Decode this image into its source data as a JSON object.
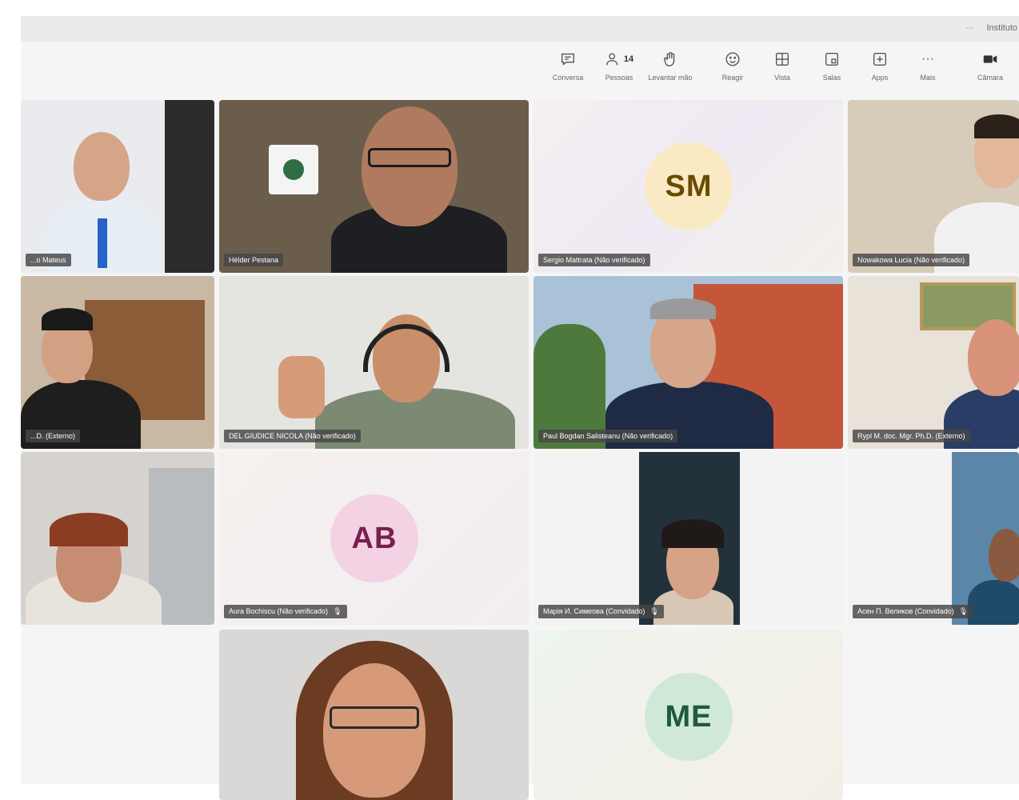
{
  "header": {
    "more_label": "···",
    "org_label": "Instituto"
  },
  "toolbar": {
    "items": [
      {
        "id": "chat",
        "label": "Conversa",
        "icon": "chat-icon"
      },
      {
        "id": "people",
        "label": "Pessoas",
        "icon": "people-icon",
        "count": "14"
      },
      {
        "id": "raise",
        "label": "Levantar mão",
        "icon": "raise-hand-icon"
      },
      {
        "id": "react",
        "label": "Reagir",
        "icon": "smiley-icon"
      },
      {
        "id": "view",
        "label": "Vista",
        "icon": "grid-view-icon"
      },
      {
        "id": "rooms",
        "label": "Salas",
        "icon": "rooms-icon"
      },
      {
        "id": "apps",
        "label": "Apps",
        "icon": "apps-icon"
      },
      {
        "id": "more",
        "label": "Mais",
        "icon": "ellipsis-icon",
        "glyph": "···"
      },
      {
        "id": "camera",
        "label": "Câmara",
        "icon": "camera-icon"
      }
    ]
  },
  "participants": [
    {
      "name": "...o Mateus",
      "type": "video"
    },
    {
      "name": "Hélder Pestana",
      "type": "video"
    },
    {
      "name": "Sergio Mattrata (Não verificado)",
      "type": "avatar",
      "initials": "SM",
      "avatar_bg": "#faeac3",
      "avatar_fg": "#6b4a00"
    },
    {
      "name": "Nowakowa Lucia (Não verificado)",
      "type": "video"
    },
    {
      "name": "...D. (Externo)",
      "type": "video"
    },
    {
      "name": "DEL GIUDICE NICOLA (Não verificado)",
      "type": "video"
    },
    {
      "name": "Paul Bogdan Salisteanu (Não verificado)",
      "type": "video"
    },
    {
      "name": "Rypl M. doc. Mgr. Ph.D. (Externo)",
      "type": "video"
    },
    {
      "name": "",
      "type": "video"
    },
    {
      "name": "Aura Bochiscu (Não verificado)",
      "type": "avatar",
      "initials": "AB",
      "avatar_bg": "#f2d2e3",
      "avatar_fg": "#7a1f4e",
      "muted": true
    },
    {
      "name": "Марiя И. Симеова (Convidado)",
      "type": "video",
      "muted": true
    },
    {
      "name": "Асен П. Великов (Convidado)",
      "type": "video",
      "muted": true
    },
    {
      "name": "",
      "type": "video",
      "muted": true
    },
    {
      "name": "",
      "type": "avatar",
      "initials": "ME",
      "avatar_bg": "#cfe8d8",
      "avatar_fg": "#1f5a3a",
      "muted": true
    }
  ],
  "mic_muted_glyph": "🎙"
}
